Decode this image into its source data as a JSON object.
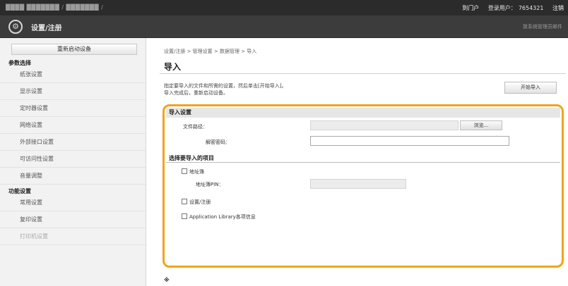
{
  "topbar": {
    "device_name": "████ ███████ / ███████ /",
    "portal_link": "到门户",
    "login_user_label": "登录用户：",
    "login_user_value": "7654321",
    "logout": "注销"
  },
  "header": {
    "title": "设置/注册",
    "admin_mail": "致系统管理员邮件"
  },
  "sidebar": {
    "restart_label": "重新启动设备",
    "section_preferences": "参数选择",
    "pref_items": [
      "纸张设置",
      "显示设置",
      "定时器设置",
      "网络设置",
      "外部接口设置",
      "可访问性设置",
      "音量调整"
    ],
    "section_function": "功能设置",
    "func_items": [
      "常用设置",
      "复印设置",
      "打印机设置"
    ]
  },
  "main": {
    "breadcrumb": "设置/注册 > 管理设置 > 数据管理 > 导入",
    "title": "导入",
    "description_line1": "指定要导入的文件和所需的设置，然后单击[开始导入]。",
    "description_line2": "导入完成后，重新启动设备。",
    "start_import_button": "开始导入",
    "import_settings_header": "导入设置",
    "file_path_label": "文件路径：",
    "browse_button": "浏览...",
    "decrypt_password_label": "解密密码：",
    "items_header": "选择要导入的项目",
    "address_book_label": "地址簿",
    "address_book_pin_label": "地址簿PIN：",
    "settings_register_label": "设置/注册",
    "app_library_label": "Application Library各项信息",
    "footnote": "※"
  },
  "colors": {
    "panel_highlight": "#f0a41c",
    "topbar_bg": "#2b2b2b",
    "header_bg": "#3c3c3c"
  }
}
